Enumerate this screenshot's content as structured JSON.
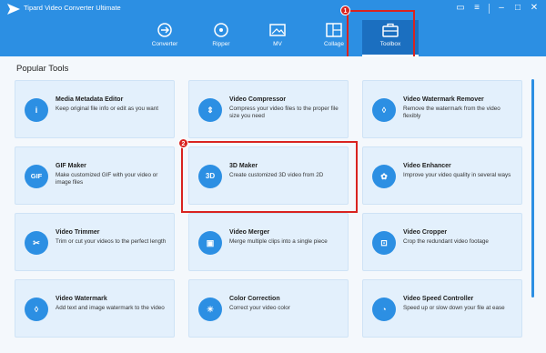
{
  "app": {
    "title": "Tipard Video Converter Ultimate"
  },
  "nav": [
    {
      "label": "Converter",
      "icon": "converter-icon"
    },
    {
      "label": "Ripper",
      "icon": "ripper-icon"
    },
    {
      "label": "MV",
      "icon": "mv-icon"
    },
    {
      "label": "Collage",
      "icon": "collage-icon"
    },
    {
      "label": "Toolbox",
      "icon": "toolbox-icon",
      "active": true
    }
  ],
  "callouts": {
    "step1": "1",
    "step2": "2"
  },
  "section": {
    "title": "Popular Tools"
  },
  "colors": {
    "header": "#2c8fe3",
    "active_tab": "#1b6fc0",
    "highlight": "#d9231f",
    "card_bg": "#e3f0fc"
  },
  "tools": [
    {
      "title": "Media Metadata Editor",
      "desc": "Keep original file info or edit as you want",
      "icon": "info-icon",
      "glyph": "i"
    },
    {
      "title": "Video Compressor",
      "desc": "Compress your video files to the proper file size you need",
      "icon": "compress-icon",
      "glyph": "⇕"
    },
    {
      "title": "Video Watermark Remover",
      "desc": "Remove the watermark from the video flexibly",
      "icon": "watermark-remove-icon",
      "glyph": "◊"
    },
    {
      "title": "GIF Maker",
      "desc": "Make customized GIF with your video or image files",
      "icon": "gif-icon",
      "glyph": "GIF"
    },
    {
      "title": "3D Maker",
      "desc": "Create customized 3D video from 2D",
      "icon": "3d-icon",
      "glyph": "3D"
    },
    {
      "title": "Video Enhancer",
      "desc": "Improve your video quality in several ways",
      "icon": "palette-icon",
      "glyph": "✿"
    },
    {
      "title": "Video Trimmer",
      "desc": "Trim or cut your videos to the perfect length",
      "icon": "scissors-icon",
      "glyph": "✂"
    },
    {
      "title": "Video Merger",
      "desc": "Merge multiple clips into a single piece",
      "icon": "merge-icon",
      "glyph": "▣"
    },
    {
      "title": "Video Cropper",
      "desc": "Crop the redundant video footage",
      "icon": "crop-icon",
      "glyph": "⊡"
    },
    {
      "title": "Video Watermark",
      "desc": "Add text and image watermark to the video",
      "icon": "drop-icon",
      "glyph": "◊"
    },
    {
      "title": "Color Correction",
      "desc": "Correct your video color",
      "icon": "sun-icon",
      "glyph": "☀"
    },
    {
      "title": "Video Speed Controller",
      "desc": "Speed up or slow down your file at ease",
      "icon": "speed-icon",
      "glyph": "◔"
    }
  ]
}
